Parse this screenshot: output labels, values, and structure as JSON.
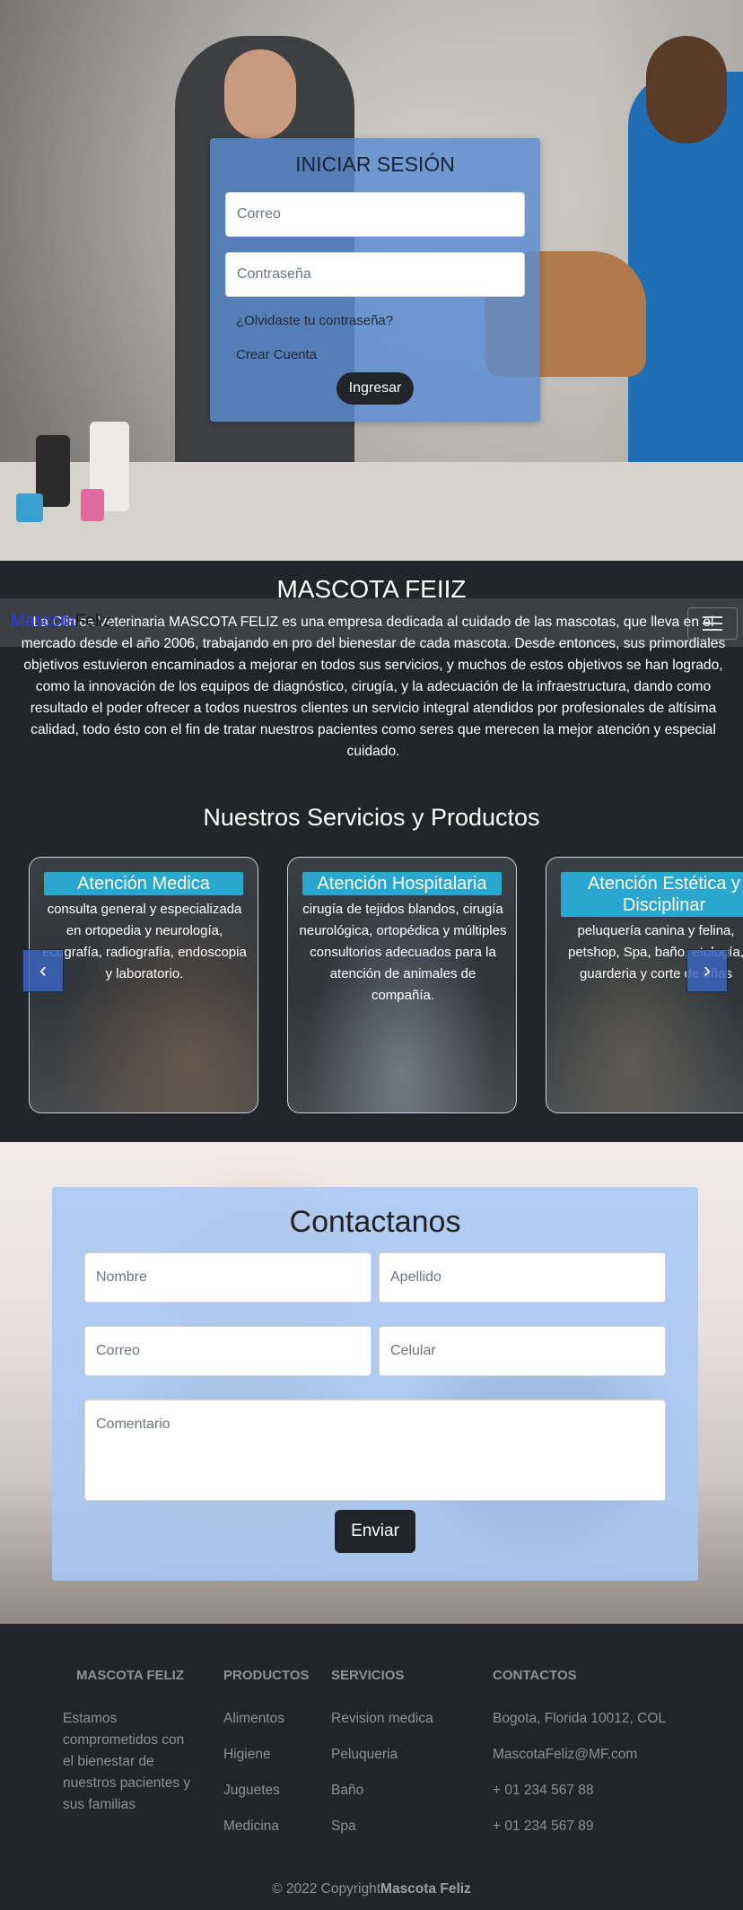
{
  "login": {
    "title": "INICIAR SESIÓN",
    "email_placeholder": "Correo",
    "password_placeholder": "Contraseña",
    "forgot_link": "¿Olvidaste tu contraseña?",
    "create_link": "Crear Cuenta",
    "submit": "Ingresar"
  },
  "navbar": {
    "brand_part1": "Mascota",
    "brand_part2": "Feliz"
  },
  "about": {
    "title": "MASCOTA FEIIZ",
    "text": "La Clinica Veterinaria MASCOTA FELIZ es una empresa dedicada al cuidado de las mascotas, que lleva en el mercado desde el año 2006, trabajando en pro del bienestar de cada mascota. Desde entonces, sus primordiales objetivos estuvieron encaminados a mejorar en todos sus servicios, y muchos de estos objetivos se han logrado, como la innovación de los equipos de diagnóstico, cirugía, y la adecuación de la infraestructura, dando como resultado el poder ofrecer a todos nuestros clientes un servicio integral atendidos por profesionales de altísima calidad, todo ésto con el fin de tratar nuestros pacientes como seres que merecen la mejor atención y especial cuidado."
  },
  "services": {
    "title": "Nuestros Servicios y Productos",
    "cards": [
      {
        "title": "Atención Medica",
        "text": "consulta general y especializada en ortopedia y neurología, ecografía, radiografía, endoscopia y laboratorio."
      },
      {
        "title": "Atención Hospitalaria",
        "text": "cirugía de tejidos blandos, cirugía neurológica, ortopédica y múltiples consultorios adecuados para la atención de animales de compañía."
      },
      {
        "title": "Atención Estética y Disciplinar",
        "text": "peluquería canina y felina, petshop, Spa, baño, etología, guarderia y corte de uñas"
      }
    ],
    "prev_icon": "chevron-left",
    "next_icon": "chevron-right"
  },
  "contact": {
    "title": "Contactanos",
    "name_placeholder": "Nombre",
    "lastname_placeholder": "Apellido",
    "email_placeholder": "Correo",
    "phone_placeholder": "Celular",
    "comment_placeholder": "Comentario",
    "submit": "Enviar"
  },
  "footer": {
    "brand_heading": "MASCOTA FELIZ",
    "brand_text": "Estamos comprometidos con el bienestar de nuestros pacientes y sus familias",
    "products_heading": "PRODUCTOS",
    "products": [
      "Alimentos",
      "Higiene",
      "Juguetes",
      "Medicina"
    ],
    "services_heading": "SERVICIOS",
    "services": [
      "Revision medica",
      "Peluqueria",
      "Baño",
      "Spa"
    ],
    "contacts_heading": "CONTACTOS",
    "contacts": [
      "Bogota, Florida 10012, COL",
      "MascotaFeliz@MF.com",
      "+ 01 234 567 88",
      "+ 01 234 567 89"
    ],
    "copyright": "© 2022 Copyright",
    "copyright_brand": "Mascota Feliz"
  },
  "colors": {
    "dark": "#212529",
    "accent": "#2aa6cf",
    "login_panel": "#5a8cd2",
    "contact_panel": "#a8c8f5"
  }
}
